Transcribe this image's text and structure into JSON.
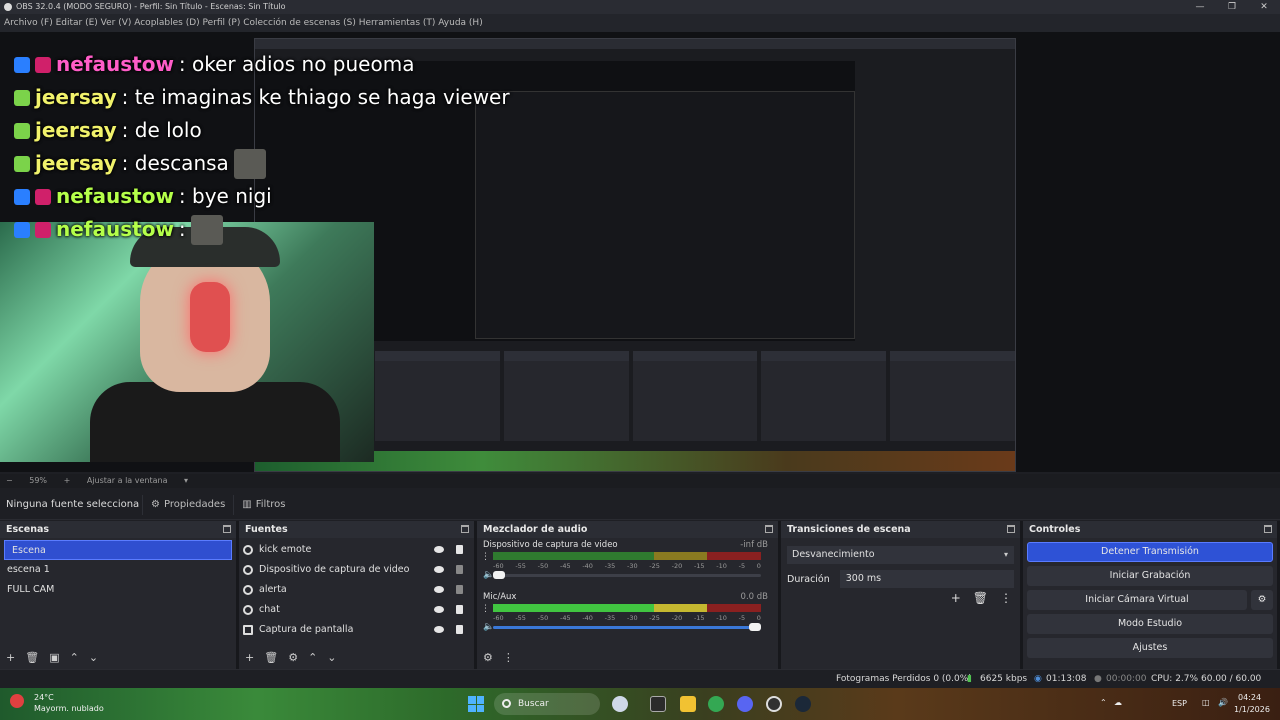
{
  "window": {
    "title": "OBS 32.0.4 (MODO SEGURO) - Perfil: Sin Título - Escenas: Sin Título",
    "menu": "Archivo (F)   Editar (E)   Ver (V)   Acoplables (D)   Perfil (P)   Colección de escenas (S)   Herramientas (T)   Ayuda (H)"
  },
  "chat": [
    {
      "user": "nefaustow",
      "msg": ": oker adios no pueoma",
      "color": "#ff5dc8"
    },
    {
      "user": "jeersay",
      "msg": ": te imaginas ke thiago se haga viewer",
      "color": "#f1f26b"
    },
    {
      "user": "jeersay",
      "msg": ": de lolo",
      "color": "#f1f26b"
    },
    {
      "user": "jeersay",
      "msg": ": descansa",
      "color": "#f1f26b"
    },
    {
      "user": "nefaustow",
      "msg": ": bye nigi",
      "color": "#b5ff4a"
    },
    {
      "user": "nefaustow",
      "msg": ":",
      "color": "#b5ff4a"
    }
  ],
  "zoom": {
    "minus": "−",
    "value": "59%",
    "plus": "+",
    "fit": "Ajustar a la ventana"
  },
  "source_toolbar": {
    "no_source": "Ninguna fuente selecciona",
    "properties": "Propiedades",
    "filters": "Filtros"
  },
  "scenes": {
    "title": "Escenas",
    "items": [
      "Escena",
      "escena 1",
      "FULL CAM"
    ]
  },
  "sources": {
    "title": "Fuentes",
    "items": [
      "kick emote",
      "Dispositivo de captura de video",
      "alerta",
      "chat",
      "Captura de pantalla"
    ]
  },
  "mixer": {
    "title": "Mezclador de audio",
    "channels": [
      {
        "name": "Dispositivo de captura de video",
        "db": "-inf dB",
        "level": 0
      },
      {
        "name": "Mic/Aux",
        "db": "0.0 dB",
        "level": 0.78
      }
    ],
    "scale": [
      "-60",
      "-55",
      "-50",
      "-45",
      "-40",
      "-35",
      "-30",
      "-25",
      "-20",
      "-15",
      "-10",
      "-5",
      "0"
    ]
  },
  "transitions": {
    "title": "Transiciones de escena",
    "selected": "Desvanecimiento",
    "duration_label": "Duración",
    "duration_value": "300 ms"
  },
  "controls": {
    "title": "Controles",
    "stop_stream": "Detener Transmisión",
    "start_recording": "Iniciar Grabación",
    "start_virtual_cam": "Iniciar Cámara Virtual",
    "studio_mode": "Modo Estudio",
    "settings": "Ajustes"
  },
  "status": {
    "dropped_frames": "Fotogramas Perdidos 0 (0.0%)",
    "bitrate": "6625 kbps",
    "stream_time": "01:13:08",
    "rec_time": "00:00:00",
    "cpu": "CPU: 2.7%",
    "fps": "60.00 / 60.00 FPS"
  },
  "taskbar": {
    "temp": "24°C",
    "weather": "Mayorm. nublado",
    "search": "Buscar",
    "lang": "ESP",
    "time": "04:24",
    "date": "1/1/2026"
  },
  "colors": {
    "accent": "#2e52d6",
    "dock_bg": "#26272d",
    "app_bg": "#1e1f24"
  }
}
